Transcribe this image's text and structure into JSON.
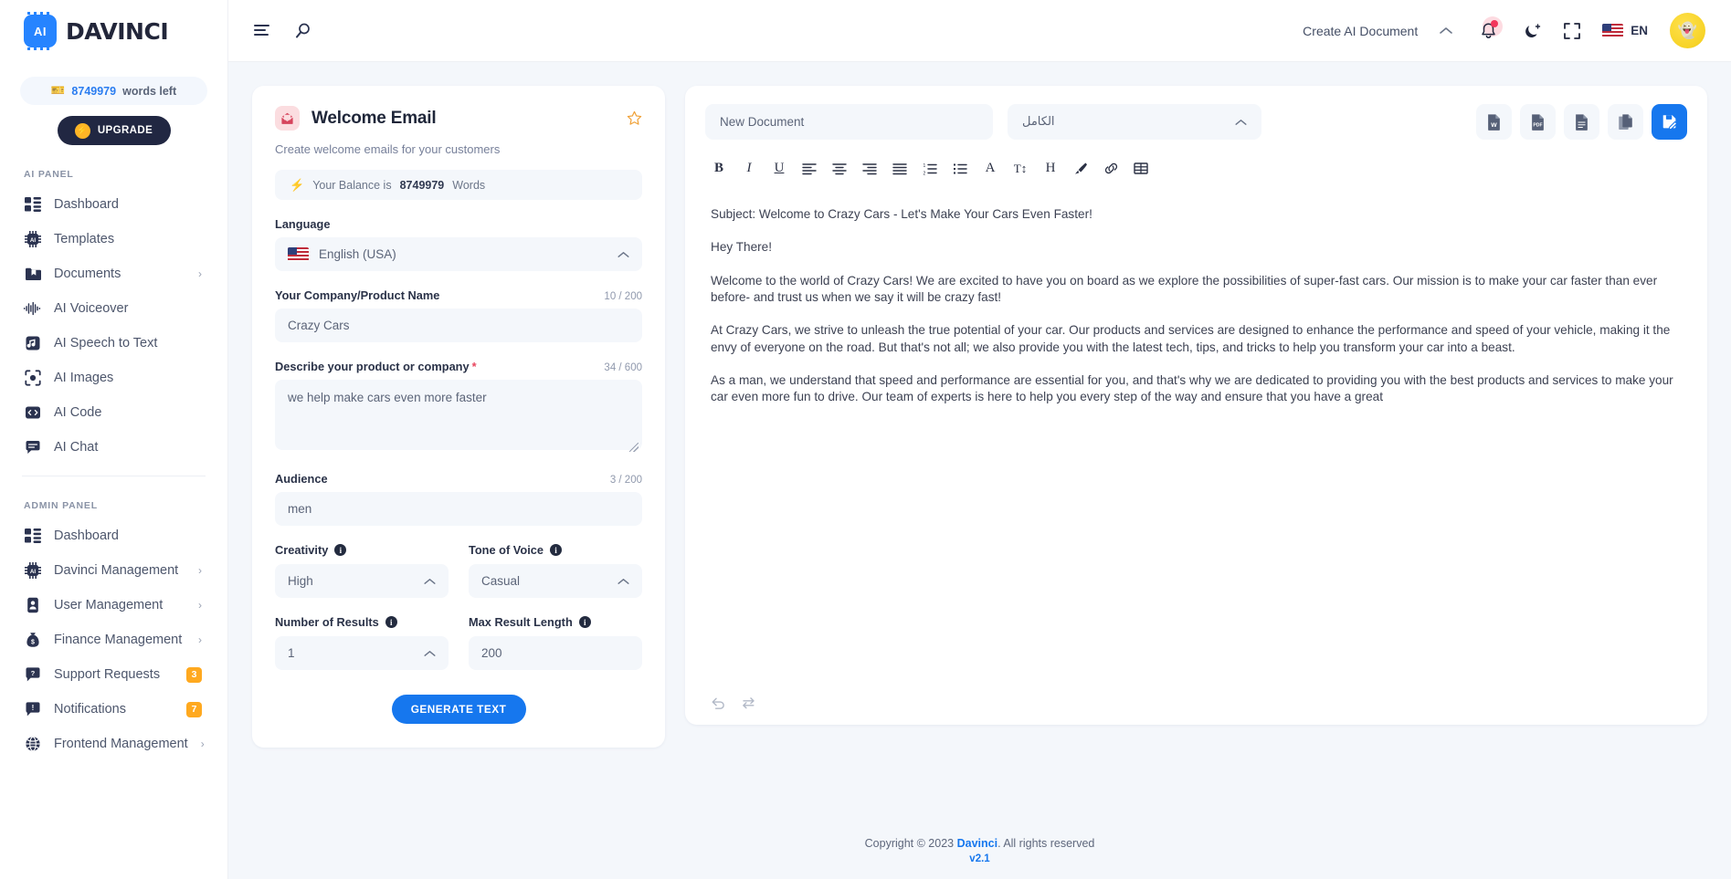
{
  "brand": {
    "name": "DAVINCI",
    "logo_text": "AI"
  },
  "sidebar": {
    "words_left": {
      "count": "8749979",
      "label": "words left"
    },
    "upgrade_label": "UPGRADE",
    "ai_panel_title": "AI PANEL",
    "admin_panel_title": "ADMIN PANEL",
    "ai_items": [
      {
        "label": "Dashboard",
        "icon": "dashboard-icon",
        "chevron": "",
        "badge": ""
      },
      {
        "label": "Templates",
        "icon": "chip-icon",
        "chevron": "",
        "badge": ""
      },
      {
        "label": "Documents",
        "icon": "folder-icon",
        "chevron": "›",
        "badge": ""
      },
      {
        "label": "AI Voiceover",
        "icon": "waveform-icon",
        "chevron": "",
        "badge": ""
      },
      {
        "label": "AI Speech to Text",
        "icon": "audio-file-icon",
        "chevron": "",
        "badge": ""
      },
      {
        "label": "AI Images",
        "icon": "camera-icon",
        "chevron": "",
        "badge": ""
      },
      {
        "label": "AI Code",
        "icon": "code-icon",
        "chevron": "",
        "badge": ""
      },
      {
        "label": "AI Chat",
        "icon": "chat-icon",
        "chevron": "",
        "badge": ""
      }
    ],
    "admin_items": [
      {
        "label": "Dashboard",
        "icon": "dashboard-icon",
        "chevron": "",
        "badge": ""
      },
      {
        "label": "Davinci Management",
        "icon": "chip-icon",
        "chevron": "›",
        "badge": ""
      },
      {
        "label": "User Management",
        "icon": "user-card-icon",
        "chevron": "›",
        "badge": ""
      },
      {
        "label": "Finance Management",
        "icon": "money-bag-icon",
        "chevron": "›",
        "badge": ""
      },
      {
        "label": "Support Requests",
        "icon": "question-bubble-icon",
        "chevron": "",
        "badge": "3"
      },
      {
        "label": "Notifications",
        "icon": "alert-bubble-icon",
        "chevron": "",
        "badge": "7"
      },
      {
        "label": "Frontend Management",
        "icon": "globe-icon",
        "chevron": "›",
        "badge": ""
      }
    ]
  },
  "topbar": {
    "create_document_label": "Create AI Document",
    "lang_code": "EN",
    "chevron": "˄"
  },
  "form": {
    "title": "Welcome Email",
    "subtitle": "Create welcome emails for your customers",
    "balance_prefix": "Your Balance is",
    "balance_value": "8749979",
    "balance_suffix": "Words",
    "language_label": "Language",
    "language_value": "English (USA)",
    "company_label": "Your Company/Product Name",
    "company_counter": "10 / 200",
    "company_value": "Crazy Cars",
    "describe_label": "Describe your product or company",
    "describe_counter": "34 / 600",
    "describe_value": "we help make cars even more faster",
    "audience_label": "Audience",
    "audience_counter": "3 / 200",
    "audience_value": "men",
    "creativity_label": "Creativity",
    "creativity_value": "High",
    "tone_label": "Tone of Voice",
    "tone_value": "Casual",
    "results_label": "Number of Results",
    "results_value": "1",
    "maxlen_label": "Max Result Length",
    "maxlen_value": "200",
    "generate_label": "GENERATE TEXT",
    "required_mark": "*",
    "info_char": "i"
  },
  "editor": {
    "doc_name_value": "New Document",
    "doc_name_placeholder": "New Document",
    "lang_select_value": "الكامل",
    "toolbar": [
      {
        "name": "bold-icon",
        "glyph": "B"
      },
      {
        "name": "italic-icon",
        "glyph": "I"
      },
      {
        "name": "underline-icon",
        "glyph": "U"
      },
      {
        "name": "align-left-icon",
        "glyph": ""
      },
      {
        "name": "align-center-icon",
        "glyph": ""
      },
      {
        "name": "align-right-icon",
        "glyph": ""
      },
      {
        "name": "align-justify-icon",
        "glyph": ""
      },
      {
        "name": "ordered-list-icon",
        "glyph": ""
      },
      {
        "name": "bullet-list-icon",
        "glyph": ""
      },
      {
        "name": "font-family-icon",
        "glyph": "A"
      },
      {
        "name": "font-size-icon",
        "glyph": "T↕"
      },
      {
        "name": "heading-icon",
        "glyph": "H"
      },
      {
        "name": "highlight-icon",
        "glyph": ""
      },
      {
        "name": "link-icon",
        "glyph": ""
      },
      {
        "name": "table-icon",
        "glyph": ""
      }
    ],
    "export_buttons": [
      {
        "name": "export-word-button",
        "label": "W"
      },
      {
        "name": "export-pdf-button",
        "label": "PDF"
      },
      {
        "name": "export-text-button",
        "label": ""
      },
      {
        "name": "copy-document-button",
        "label": ""
      },
      {
        "name": "save-document-button",
        "label": ""
      }
    ],
    "document_paragraphs": [
      "Subject: Welcome to Crazy Cars - Let's Make Your Cars Even Faster!",
      "Hey There!",
      "Welcome to the world of Crazy Cars! We are excited to have you on board as we explore the possibilities of super-fast cars. Our mission is to make your car faster than ever before- and trust us when we say it will be crazy fast!",
      "At Crazy Cars, we strive to unleash the true potential of your car. Our products and services are designed to enhance the performance and speed of your vehicle, making it the envy of everyone on the road. But that's not all; we also provide you with the latest tech, tips, and tricks to help you transform your car into a beast.",
      "As a man, we understand that speed and performance are essential for you, and that's why we are dedicated to providing you with the best products and services to make your car even more fun to drive. Our team of experts is here to help you every step of the way and ensure that you have a great"
    ]
  },
  "footer": {
    "copyright_prefix": "Copyright © 2023",
    "brand": "Davinci",
    "copyright_suffix": ". All rights reserved",
    "version": "v2.1"
  },
  "colors": {
    "accent": "#1677ee",
    "badge": "#ffa91f",
    "dark": "#212742",
    "danger": "#f2355c"
  }
}
